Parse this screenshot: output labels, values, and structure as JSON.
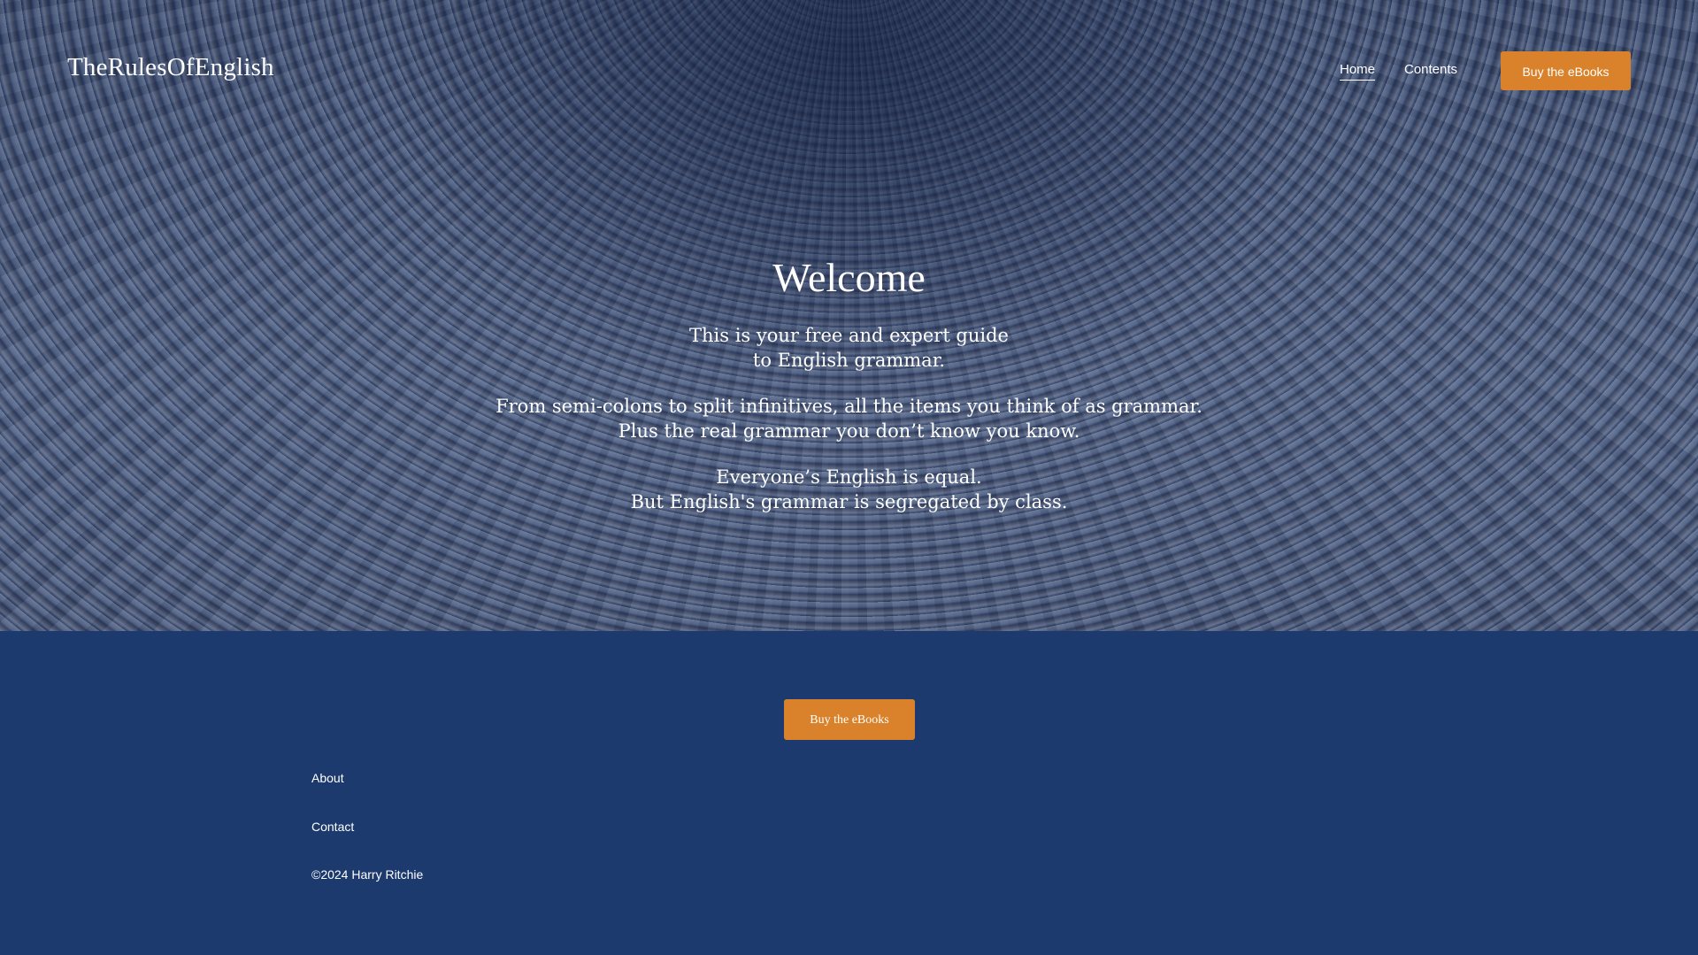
{
  "header": {
    "logo": "TheRulesOfEnglish",
    "nav": {
      "home": "Home",
      "contents": "Contents"
    },
    "cta_label": "Buy the eBooks"
  },
  "hero": {
    "title": "Welcome",
    "lines": [
      "This is your free and expert guide",
      "to English grammar.",
      "From semi-colons to split infinitives, all the items you think of as grammar.",
      "Plus the real grammar you don’t know you know.",
      "Everyone’s English is equal.",
      "But English's grammar is segregated by class."
    ]
  },
  "footer": {
    "cta_label": "Buy the eBooks",
    "links": {
      "about": "About",
      "contact": "Contact"
    },
    "copyright": "©2024 Harry Ritchie"
  },
  "colors": {
    "accent": "#d9822b",
    "footer_bg": "#1c3a6e",
    "text": "#ffffff"
  }
}
